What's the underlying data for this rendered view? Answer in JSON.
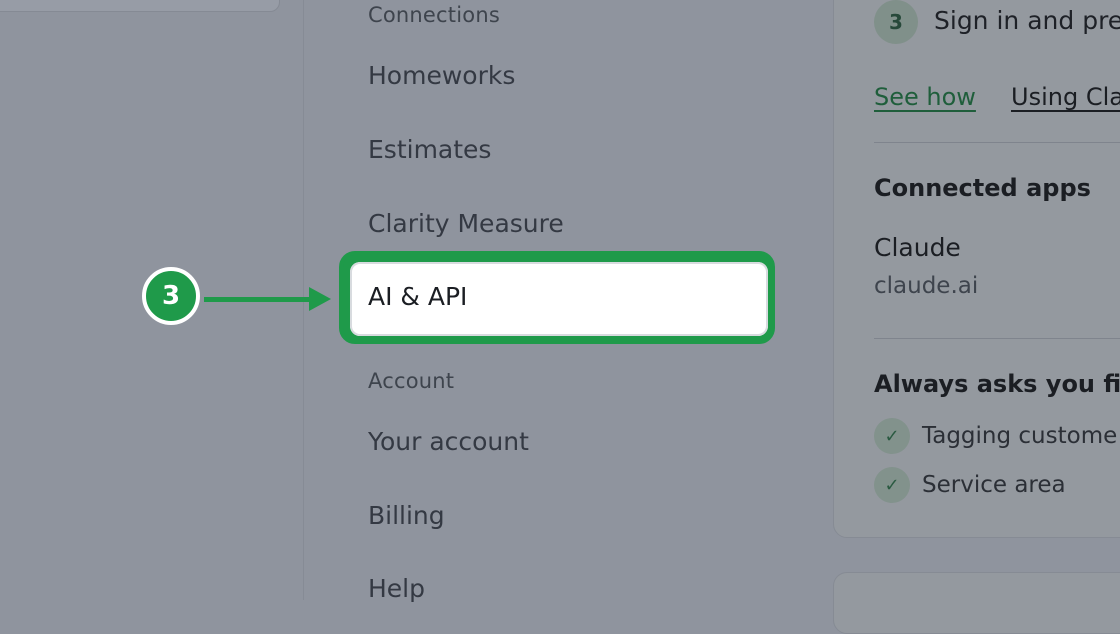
{
  "nav": {
    "section_connections": "Connections",
    "items_connections": [
      "Homeworks",
      "Estimates",
      "Clarity Measure"
    ],
    "selected_item": "AI & API",
    "section_account": "Account",
    "items_account": [
      "Your account",
      "Billing",
      "Help"
    ]
  },
  "callout": {
    "step_number": "3"
  },
  "right": {
    "step": {
      "number": "3",
      "text": "Sign in and pre"
    },
    "links": {
      "see_how": "See how",
      "using": "Using Cla"
    },
    "connected_apps": {
      "heading": "Connected apps",
      "app_name": "Claude",
      "app_url": "claude.ai"
    },
    "always_asks": {
      "heading": "Always asks you fi",
      "items": [
        "Tagging custome",
        "Service area"
      ]
    }
  },
  "colors": {
    "accent_green": "#1f9a4a",
    "overlay": "#8f949e"
  },
  "icons": {
    "check": "check-icon",
    "arrow": "arrow-right-icon"
  }
}
